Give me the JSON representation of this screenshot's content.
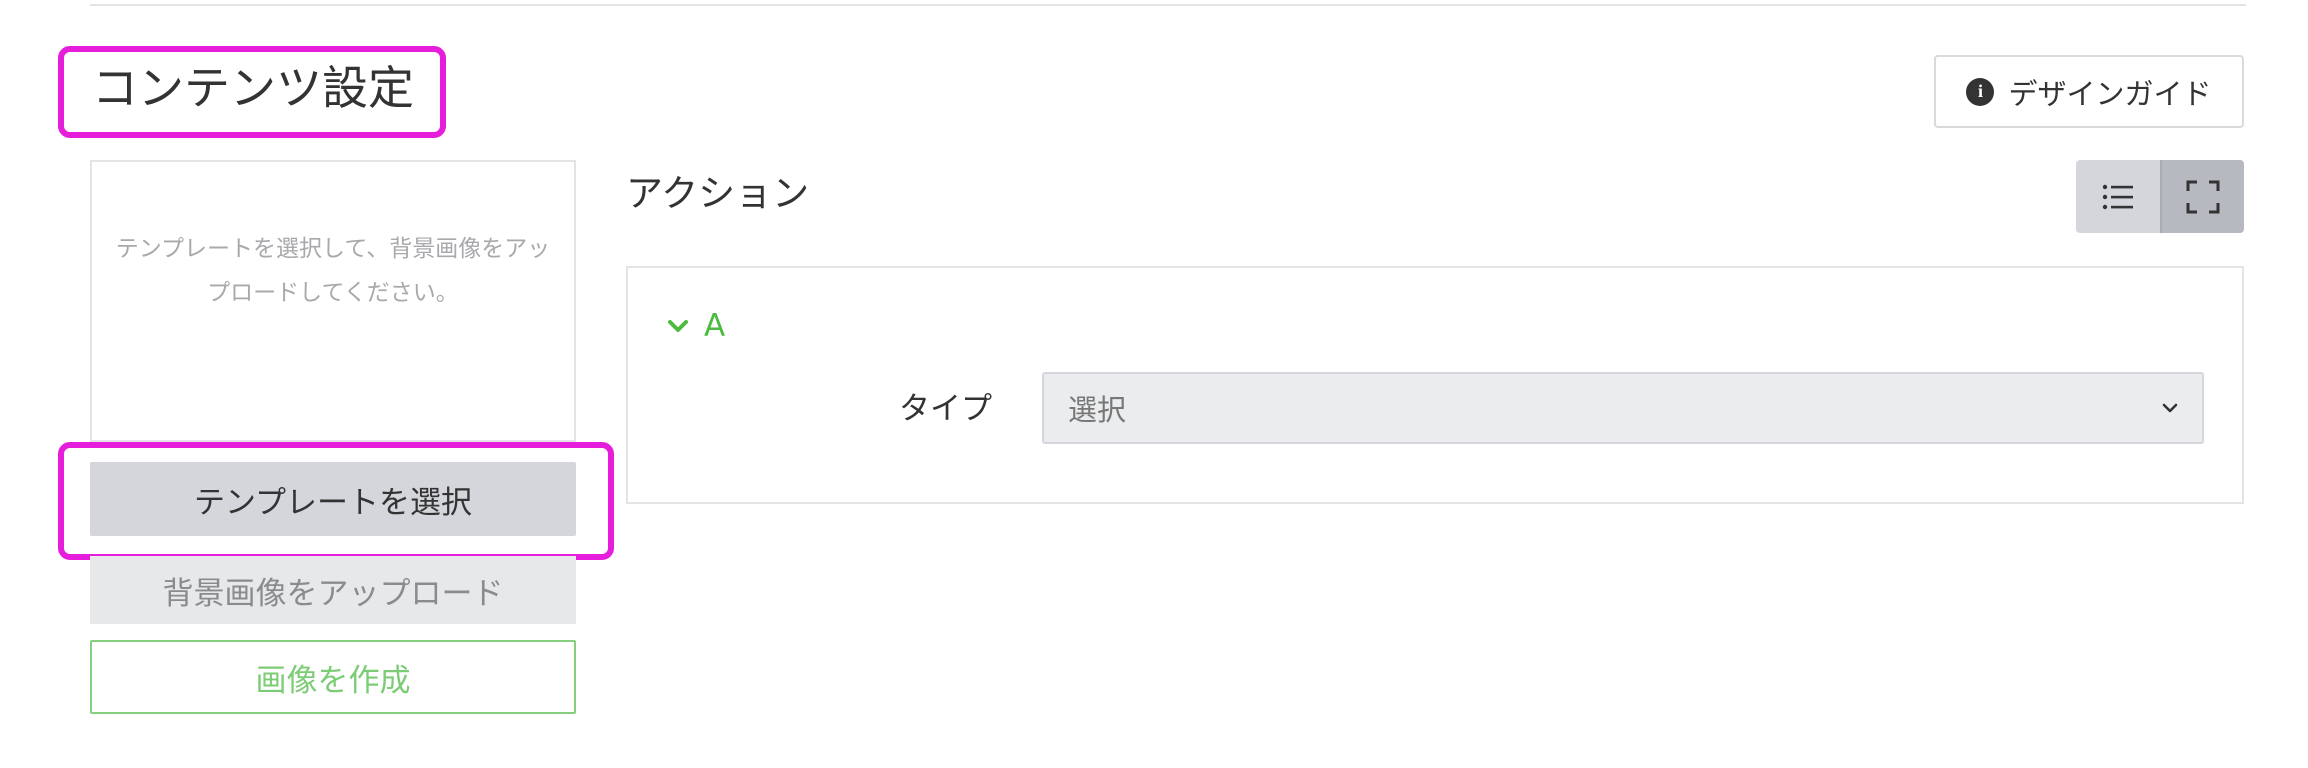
{
  "section": {
    "title": "コンテンツ設定",
    "design_guide_label": "デザインガイド"
  },
  "preview": {
    "placeholder_line1": "テンプレートを選択して、背景画像をアッ",
    "placeholder_line2": "プロードしてください。"
  },
  "buttons": {
    "select_template": "テンプレートを選択",
    "upload_background": "背景画像をアップロード",
    "create_image": "画像を作成"
  },
  "action": {
    "title": "アクション",
    "view_modes": [
      "list-icon",
      "fullscreen-icon"
    ],
    "accordion_label": "A",
    "type_label": "タイプ",
    "type_select_value": "選択"
  },
  "colors": {
    "highlight": "#e61edc",
    "accent_green": "#4cbb3f",
    "create_green": "#7ccc75"
  }
}
